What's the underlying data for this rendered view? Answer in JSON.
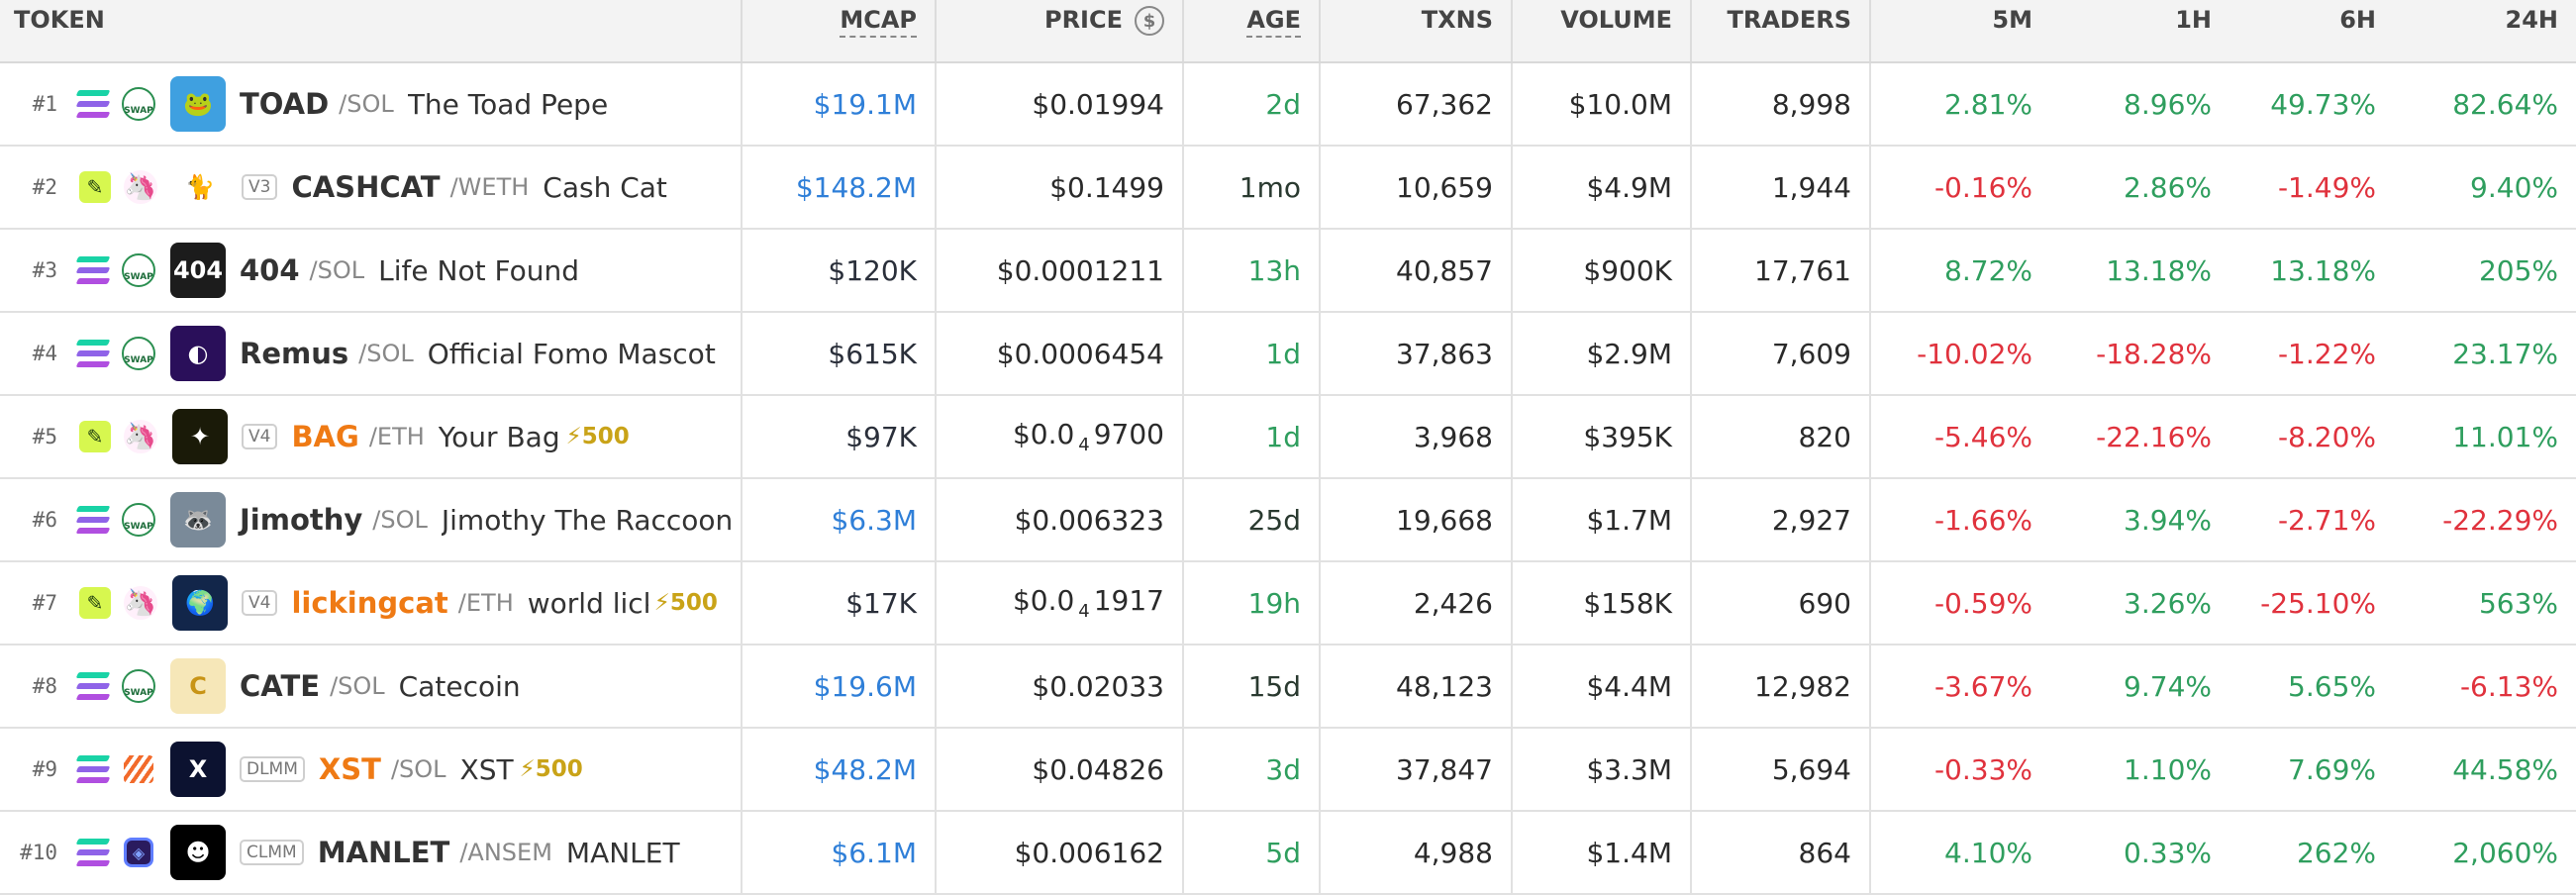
{
  "columns": {
    "token": "TOKEN",
    "mcap": "MCAP",
    "price": "PRICE",
    "price_icon": "dollar-circle-icon",
    "age": "AGE",
    "txns": "TXNS",
    "volume": "VOLUME",
    "traders": "TRADERS",
    "m5": "5M",
    "h1": "1H",
    "h6": "6H",
    "h24": "24H"
  },
  "colors": {
    "positive": "#2f9e5e",
    "negative": "#e0323d",
    "mcap_blue": "#2f7fd8",
    "boost": "#c9a318"
  },
  "rows": [
    {
      "rank": "#1",
      "chain": "solana-icon",
      "dex": "swap-icon",
      "dex_text": "SWAP",
      "avatar_bg": "#3fa0e0",
      "avatar_glyph": "🐸",
      "badge": "",
      "symbol": "TOAD",
      "quote": "/SOL",
      "name": "The Toad Pepe",
      "boost": "",
      "mcap": "$19.1M",
      "mcap_style": "blue",
      "price": "$0.01994",
      "age": "2d",
      "age_style": "age-green",
      "txns": "67,362",
      "volume": "$10.0M",
      "traders": "8,998",
      "m5": "2.81%",
      "m5_s": "green",
      "h1": "8.96%",
      "h1_s": "green",
      "h6": "49.73%",
      "h6_s": "green",
      "h24": "82.64%",
      "h24_s": "green"
    },
    {
      "rank": "#2",
      "chain": "leaf-icon",
      "dex": "uniswap-icon",
      "dex_text": "🦄",
      "avatar_bg": "#ffffff",
      "avatar_glyph": "🐈",
      "badge": "V3",
      "symbol": "CASHCAT",
      "quote": "/WETH",
      "name": "Cash Cat",
      "boost": "",
      "mcap": "$148.2M",
      "mcap_style": "blue",
      "price": "$0.1499",
      "age": "1mo",
      "age_style": "age-dark",
      "txns": "10,659",
      "volume": "$4.9M",
      "traders": "1,944",
      "m5": "-0.16%",
      "m5_s": "red",
      "h1": "2.86%",
      "h1_s": "green",
      "h6": "-1.49%",
      "h6_s": "red",
      "h24": "9.40%",
      "h24_s": "green"
    },
    {
      "rank": "#3",
      "chain": "solana-icon",
      "dex": "swap-icon",
      "dex_text": "SWAP",
      "avatar_bg": "#1c1c1c",
      "avatar_glyph": "404",
      "badge": "",
      "symbol": "404",
      "quote": "/SOL",
      "name": "Life Not Found",
      "boost": "",
      "mcap": "$120K",
      "mcap_style": "dark",
      "price": "$0.0001211",
      "age": "13h",
      "age_style": "age-green",
      "txns": "40,857",
      "volume": "$900K",
      "traders": "17,761",
      "m5": "8.72%",
      "m5_s": "green",
      "h1": "13.18%",
      "h1_s": "green",
      "h6": "13.18%",
      "h6_s": "green",
      "h24": "205%",
      "h24_s": "green"
    },
    {
      "rank": "#4",
      "chain": "solana-icon",
      "dex": "swap-icon",
      "dex_text": "SWAP",
      "avatar_bg": "#2a0f5a",
      "avatar_glyph": "◐",
      "badge": "",
      "symbol": "Remus",
      "quote": "/SOL",
      "name": "Official Fomo Mascot",
      "boost": "",
      "mcap": "$615K",
      "mcap_style": "dark",
      "price": "$0.0006454",
      "age": "1d",
      "age_style": "age-green",
      "txns": "37,863",
      "volume": "$2.9M",
      "traders": "7,609",
      "m5": "-10.02%",
      "m5_s": "red",
      "h1": "-18.28%",
      "h1_s": "red",
      "h6": "-1.22%",
      "h6_s": "red",
      "h24": "23.17%",
      "h24_s": "green"
    },
    {
      "rank": "#5",
      "chain": "leaf-icon",
      "dex": "uniswap-icon",
      "dex_text": "🦄",
      "avatar_bg": "#1a1a08",
      "avatar_glyph": "✦",
      "badge": "V4",
      "symbol": "BAG",
      "quote": "/ETH",
      "name": "Your Bag",
      "boost": "⚡500",
      "mcap": "$97K",
      "mcap_style": "dark",
      "price_pre": "$0.0",
      "price_sub": "4",
      "price_post": "9700",
      "age": "1d",
      "age_style": "age-green",
      "txns": "3,968",
      "volume": "$395K",
      "traders": "820",
      "m5": "-5.46%",
      "m5_s": "red",
      "h1": "-22.16%",
      "h1_s": "red",
      "h6": "-8.20%",
      "h6_s": "red",
      "h24": "11.01%",
      "h24_s": "green"
    },
    {
      "rank": "#6",
      "chain": "solana-icon",
      "dex": "swap-icon",
      "dex_text": "SWAP",
      "avatar_bg": "#7a8a99",
      "avatar_glyph": "🦝",
      "badge": "",
      "symbol": "Jimothy",
      "quote": "/SOL",
      "name": "Jimothy The Raccoon",
      "boost": "",
      "mcap": "$6.3M",
      "mcap_style": "blue",
      "price": "$0.006323",
      "age": "25d",
      "age_style": "age-dark",
      "txns": "19,668",
      "volume": "$1.7M",
      "traders": "2,927",
      "m5": "-1.66%",
      "m5_s": "red",
      "h1": "3.94%",
      "h1_s": "green",
      "h6": "-2.71%",
      "h6_s": "red",
      "h24": "-22.29%",
      "h24_s": "red"
    },
    {
      "rank": "#7",
      "chain": "leaf-icon",
      "dex": "uniswap-icon",
      "dex_text": "🦄",
      "avatar_bg": "#12264a",
      "avatar_glyph": "🌍",
      "badge": "V4",
      "symbol": "lickingcat",
      "quote": "/ETH",
      "name": "world licking c",
      "boost": "⚡500",
      "mcap": "$17K",
      "mcap_style": "dark",
      "price_pre": "$0.0",
      "price_sub": "4",
      "price_post": "1917",
      "age": "19h",
      "age_style": "age-green",
      "txns": "2,426",
      "volume": "$158K",
      "traders": "690",
      "m5": "-0.59%",
      "m5_s": "red",
      "h1": "3.26%",
      "h1_s": "green",
      "h6": "-25.10%",
      "h6_s": "red",
      "h24": "563%",
      "h24_s": "green"
    },
    {
      "rank": "#8",
      "chain": "solana-icon",
      "dex": "swap-icon",
      "dex_text": "SWAP",
      "avatar_bg": "#f6e7b8",
      "avatar_glyph": "C",
      "badge": "",
      "symbol": "CATE",
      "quote": "/SOL",
      "name": "Catecoin",
      "boost": "",
      "mcap": "$19.6M",
      "mcap_style": "blue",
      "price": "$0.02033",
      "age": "15d",
      "age_style": "age-dark",
      "txns": "48,123",
      "volume": "$4.4M",
      "traders": "12,982",
      "m5": "-3.67%",
      "m5_s": "red",
      "h1": "9.74%",
      "h1_s": "green",
      "h6": "5.65%",
      "h6_s": "green",
      "h24": "-6.13%",
      "h24_s": "red"
    },
    {
      "rank": "#9",
      "chain": "solana-icon",
      "dex": "meteora-icon",
      "dex_text": "",
      "avatar_bg": "#0c1230",
      "avatar_glyph": "X",
      "badge": "DLMM",
      "symbol": "XST",
      "quote": "/SOL",
      "name": "XST",
      "boost": "⚡500",
      "mcap": "$48.2M",
      "mcap_style": "blue",
      "price": "$0.04826",
      "age": "3d",
      "age_style": "age-green",
      "txns": "37,847",
      "volume": "$3.3M",
      "traders": "5,694",
      "m5": "-0.33%",
      "m5_s": "red",
      "h1": "1.10%",
      "h1_s": "green",
      "h6": "7.69%",
      "h6_s": "green",
      "h24": "44.58%",
      "h24_s": "green"
    },
    {
      "rank": "#10",
      "chain": "solana-icon",
      "dex": "raydium-icon",
      "dex_text": "◈",
      "avatar_bg": "#000000",
      "avatar_glyph": "☻",
      "badge": "CLMM",
      "symbol": "MANLET",
      "quote": "/ANSEM",
      "name": "MANLET",
      "boost": "",
      "mcap": "$6.1M",
      "mcap_style": "blue",
      "price": "$0.006162",
      "age": "5d",
      "age_style": "age-green",
      "txns": "4,988",
      "volume": "$1.4M",
      "traders": "864",
      "m5": "4.10%",
      "m5_s": "green",
      "h1": "0.33%",
      "h1_s": "green",
      "h6": "262%",
      "h6_s": "green",
      "h24": "2,060%",
      "h24_s": "green"
    }
  ]
}
